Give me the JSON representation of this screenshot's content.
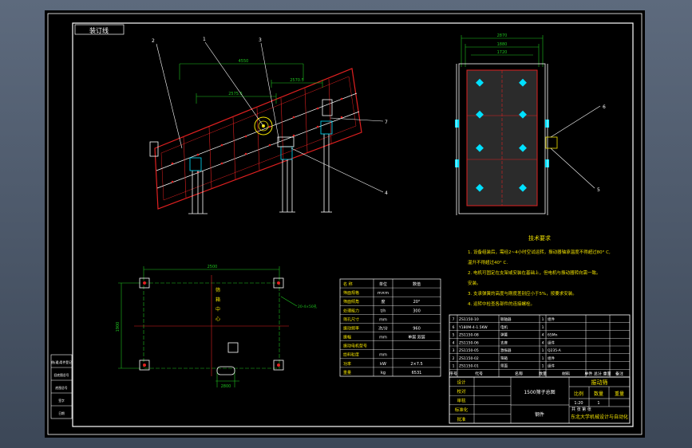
{
  "drawing": {
    "corner_tab": "装订线",
    "title": "振动筛",
    "drawing_name": "1500筛子总图",
    "material": "钢件",
    "company": "东北大学机械设计与自动化",
    "scale_label": "比例",
    "qty_label": "数量",
    "weight_label": "重量",
    "scale_value": "1:20",
    "qty_value": "1"
  },
  "callouts": [
    "2",
    "1",
    "3",
    "7",
    "4",
    "6",
    "5"
  ],
  "dimensions": {
    "side_total": "4550",
    "side_upper": "2570.5",
    "side_mid": "2575.5",
    "front_outer": "2870",
    "front_mid": "1880",
    "front_inner": "1720",
    "plan_width": "2500",
    "plan_length": "1900",
    "plan_depth": "2800",
    "plan_bolt": "20-4×50孔",
    "plan_note": "5"
  },
  "plan_vertical_label": "筛箱中心",
  "tech_requirements": {
    "title": "技术要求",
    "items": [
      "1. 设备组装后，需经2~4小时空试运转，振动器轴承温度不得超过80° C,",
      "温升不得超过40° C.",
      "2. 电机可固定在支架或安装在基础上，但电机与振动器转向需一致。",
      "安装。",
      "3. 支承弹簧的高度与刚度差别应小于5%，按要求安装。",
      "4. 运转中检查各部件的连接螺栓。"
    ]
  },
  "spec_table": [
    {
      "name": "名 称",
      "unit": "单位",
      "value": "数值"
    },
    {
      "name": "筛面规格",
      "unit": "m×m",
      "value": ""
    },
    {
      "name": "筛面倾角",
      "unit": "度",
      "value": "20°"
    },
    {
      "name": "处理能力",
      "unit": "t/h",
      "value": "300"
    },
    {
      "name": "筛孔尺寸",
      "unit": "mm",
      "value": ""
    },
    {
      "name": "振动频率",
      "unit": "次/分",
      "value": "960"
    },
    {
      "name": "振幅",
      "unit": "mm",
      "value": "单层 双层"
    },
    {
      "name": "振动电机型号",
      "unit": "",
      "value": ""
    },
    {
      "name": "给料粒度",
      "unit": "mm",
      "value": ""
    },
    {
      "name": "功率",
      "unit": "kW",
      "value": "2×7.5"
    },
    {
      "name": "重量",
      "unit": "kg",
      "value": "6531"
    }
  ],
  "parts_header": {
    "seq": "序号",
    "code": "代号",
    "name": "名称",
    "qty": "数量",
    "material": "材料",
    "weight": "单件 总计 重量",
    "note": "备注"
  },
  "parts_list": [
    {
      "seq": "7",
      "code": "ZS1150-10",
      "name": "联轴器",
      "qty": "1",
      "material": "组件"
    },
    {
      "seq": "6",
      "code": "Y180M-4-1.5KW",
      "name": "电机",
      "qty": "1",
      "material": ""
    },
    {
      "seq": "5",
      "code": "ZS1150-08",
      "name": "弹簧",
      "qty": "4",
      "material": "65Mn"
    },
    {
      "seq": "4",
      "code": "ZS1150-06",
      "name": "支座",
      "qty": "4",
      "material": "组件"
    },
    {
      "seq": "3",
      "code": "ZS1150-05",
      "name": "激振器",
      "qty": "1",
      "material": "Q235-A"
    },
    {
      "seq": "2",
      "code": "ZS1150-02",
      "name": "筛箱",
      "qty": "1",
      "material": "组件"
    },
    {
      "seq": "1",
      "code": "ZS1150-01",
      "name": "筛面",
      "qty": "1",
      "material": "组件"
    }
  ],
  "title_block": {
    "rows": [
      "设计",
      "校对",
      "审核",
      "标准化",
      "批准"
    ],
    "sheet": "共 张 第 张"
  },
  "left_strip": [
    "借(通)用件登记",
    "旧底图总号",
    "底图总号",
    "签字",
    "日期"
  ],
  "colors": {
    "background": "#000000",
    "frame": "#ffffff",
    "red": "#e02020",
    "green": "#1fc41f",
    "yellow": "#f0e000",
    "cyan": "#00e0ff",
    "magenta": "#ff40ff"
  }
}
